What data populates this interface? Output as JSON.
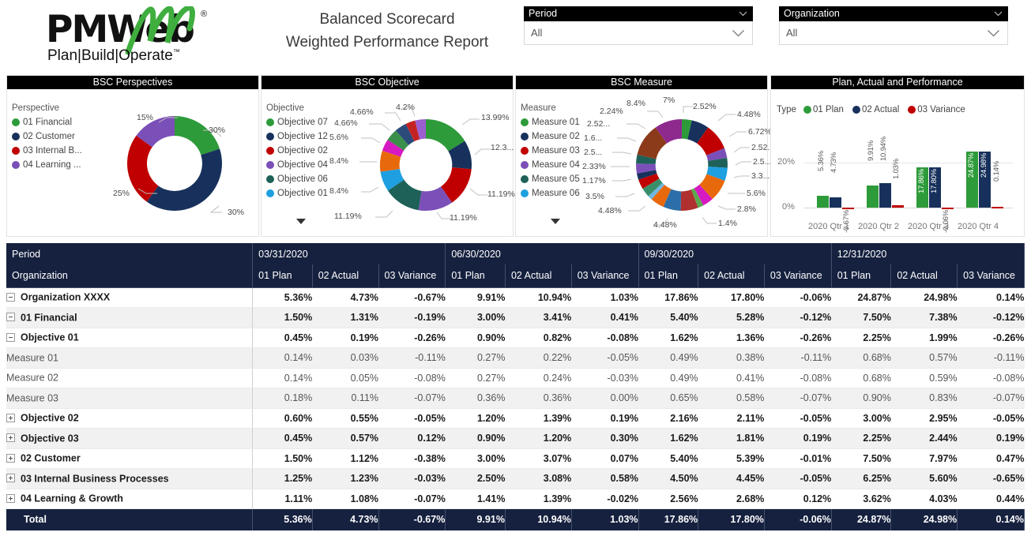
{
  "header": {
    "logo_main": "PMWeb",
    "logo_registered": "®",
    "logo_tagline": "Plan|Build|Operate",
    "logo_tm": "™",
    "title_line1": "Balanced Scorecard",
    "title_line2": "Weighted Performance Report"
  },
  "slicers": [
    {
      "name": "Period",
      "label": "Period",
      "value": "All"
    },
    {
      "name": "Organization",
      "label": "Organization",
      "value": "All"
    }
  ],
  "colors": {
    "green": "#2e9b3a",
    "navy": "#17315c",
    "red": "#c00000",
    "purple": "#7b4fb8",
    "teal": "#1d6158",
    "blue": "#1e9fe0",
    "header_bg": "#16213f",
    "card_title_bg": "#000000"
  },
  "cards": [
    {
      "name": "bsc-perspectives",
      "title": "BSC Perspectives"
    },
    {
      "name": "bsc-objective",
      "title": "BSC Objective"
    },
    {
      "name": "bsc-measure",
      "title": "BSC Measure"
    },
    {
      "name": "plan-actual-performance",
      "title": "Plan, Actual and Performance"
    }
  ],
  "chart_data": [
    {
      "type": "pie",
      "name": "bsc-perspectives",
      "title": "BSC Perspectives",
      "legend_title": "Perspective",
      "legend_position": "left",
      "categories": [
        "01 Financial",
        "02 Customer",
        "03 Internal B...",
        "04 Learning ..."
      ],
      "values": [
        30,
        30,
        25,
        15
      ],
      "data_labels": [
        "30%",
        "30%",
        "25%",
        "15%"
      ],
      "colors": [
        "#2e9b3a",
        "#17315c",
        "#c00000",
        "#7b4fb8"
      ]
    },
    {
      "type": "pie",
      "name": "bsc-objective",
      "title": "BSC Objective",
      "legend_title": "Objective",
      "legend_position": "left",
      "legend_visible": [
        "Objective 07",
        "Objective 12",
        "Objective 02",
        "Objective 04",
        "Objective 06",
        "Objective 01"
      ],
      "legend_colors": [
        "#2e9b3a",
        "#17315c",
        "#c00000",
        "#7b4fb8",
        "#1d6158",
        "#1e9fe0"
      ],
      "legend_truncated": true,
      "values": [
        13.99,
        12.3,
        11.19,
        11.19,
        11.19,
        8.4,
        8.4,
        5.6,
        4.66,
        4.66,
        4.2
      ],
      "data_labels": [
        "13.99%",
        "12.3...",
        "11.19%",
        "11.19%",
        "11.19%",
        "8.4%",
        "8.4%",
        "5.6%",
        "4.66%",
        "4.66%",
        "4.2%"
      ],
      "colors": [
        "#2e9b3a",
        "#17315c",
        "#c00000",
        "#7b4fb8",
        "#1d6158",
        "#1e9fe0",
        "#e8690b",
        "#d619c0",
        "#2e9b3a",
        "#17315c",
        "#c00000"
      ]
    },
    {
      "type": "pie",
      "name": "bsc-measure",
      "title": "BSC Measure",
      "legend_title": "Measure",
      "legend_position": "left",
      "legend_visible": [
        "Measure 01",
        "Measure 02",
        "Measure 03",
        "Measure 04",
        "Measure 05",
        "Measure 06"
      ],
      "legend_colors": [
        "#2e9b3a",
        "#17315c",
        "#c00000",
        "#7b4fb8",
        "#1d6158",
        "#1e9fe0"
      ],
      "legend_truncated": true,
      "values": [
        2.52,
        4.48,
        6.72,
        2.52,
        2.5,
        3.3,
        5.6,
        2.8,
        1.4,
        4.48,
        4.48,
        3.5,
        1.17,
        2.33,
        2.5,
        1.6,
        2.52,
        2.24,
        8.4,
        7
      ],
      "data_labels": [
        "2.52%",
        "4.48%",
        "6.72%",
        "2.52...",
        "2.5...",
        "3.3...",
        "5.6%",
        "2.8%",
        "1.4%",
        "4.48%",
        "4.48%",
        "3.5%",
        "1.17%",
        "2.33%",
        "2.5...",
        "1.6...",
        "2.52...",
        "2.24%",
        "8.4%",
        "7%"
      ],
      "colors": [
        "#2e9b3a",
        "#17315c",
        "#c00000",
        "#7b4fb8",
        "#1d6158",
        "#1e9fe0",
        "#e8690b",
        "#d619c0",
        "#5aa84f",
        "#b03030",
        "#2c6fa8",
        "#e8690b",
        "#6fb8e0",
        "#3a8f6a",
        "#c00000",
        "#17315c",
        "#7b4fb8",
        "#1d6158",
        "#8b3a1a",
        "#8e2a8e"
      ]
    },
    {
      "type": "bar",
      "name": "plan-actual-performance",
      "title": "Plan, Actual and Performance",
      "legend_title": "Type",
      "legend_position": "top",
      "categories": [
        "2020 Qtr 1",
        "2020 Qtr 2",
        "2020 Qtr 3",
        "2020 Qtr 4"
      ],
      "series": [
        {
          "name": "01 Plan",
          "color": "#2e9b3a",
          "values": [
            5.36,
            9.91,
            17.86,
            24.87
          ],
          "labels": [
            "5.36%",
            "9.91%",
            "17.86%",
            "24.87%"
          ]
        },
        {
          "name": "02 Actual",
          "color": "#17315c",
          "values": [
            4.73,
            10.94,
            17.8,
            24.98
          ],
          "labels": [
            "4.73%",
            "10.94%",
            "17.80%",
            "24.98%"
          ]
        },
        {
          "name": "03 Variance",
          "color": "#c00000",
          "values": [
            -0.67,
            1.03,
            -0.06,
            0.14
          ],
          "labels": [
            "-0.67%",
            "1.03%",
            "-0.06%",
            "0.14%"
          ]
        }
      ],
      "ylabel": "",
      "xlabel": "",
      "ytick_labels": [
        "0%",
        "20%"
      ],
      "ylim": [
        -2,
        28
      ],
      "grid": true
    }
  ],
  "matrix": {
    "row_header_label_1": "Period",
    "row_header_label_2": "Organization",
    "period_groups": [
      "03/31/2020",
      "06/30/2020",
      "09/30/2020",
      "12/31/2020"
    ],
    "measure_columns": [
      "01 Plan",
      "02 Actual",
      "03 Variance"
    ],
    "rows": [
      {
        "label": "Organization XXXX",
        "indent": 0,
        "toggle": "minus",
        "bold": true,
        "values": [
          "5.36%",
          "4.73%",
          "-0.67%",
          "9.91%",
          "10.94%",
          "1.03%",
          "17.86%",
          "17.80%",
          "-0.06%",
          "24.87%",
          "24.98%",
          "0.14%"
        ]
      },
      {
        "label": "01 Financial",
        "indent": 1,
        "toggle": "minus",
        "bold": true,
        "values": [
          "1.50%",
          "1.31%",
          "-0.19%",
          "3.00%",
          "3.41%",
          "0.41%",
          "5.40%",
          "5.28%",
          "-0.12%",
          "7.50%",
          "7.38%",
          "-0.12%"
        ]
      },
      {
        "label": "Objective 01",
        "indent": 2,
        "toggle": "minus",
        "bold": true,
        "values": [
          "0.45%",
          "0.19%",
          "-0.26%",
          "0.90%",
          "0.82%",
          "-0.08%",
          "1.62%",
          "1.36%",
          "-0.26%",
          "2.25%",
          "1.99%",
          "-0.26%"
        ]
      },
      {
        "label": "Measure 01",
        "indent": 3,
        "toggle": "none",
        "bold": false,
        "values": [
          "0.14%",
          "0.03%",
          "-0.11%",
          "0.27%",
          "0.22%",
          "-0.05%",
          "0.49%",
          "0.38%",
          "-0.11%",
          "0.68%",
          "0.57%",
          "-0.11%"
        ]
      },
      {
        "label": "Measure 02",
        "indent": 3,
        "toggle": "none",
        "bold": false,
        "values": [
          "0.14%",
          "0.05%",
          "-0.08%",
          "0.27%",
          "0.24%",
          "-0.03%",
          "0.49%",
          "0.41%",
          "-0.08%",
          "0.68%",
          "0.59%",
          "-0.08%"
        ]
      },
      {
        "label": "Measure 03",
        "indent": 3,
        "toggle": "none",
        "bold": false,
        "values": [
          "0.18%",
          "0.11%",
          "-0.07%",
          "0.36%",
          "0.36%",
          "0.00%",
          "0.65%",
          "0.58%",
          "-0.07%",
          "0.90%",
          "0.83%",
          "-0.07%"
        ]
      },
      {
        "label": "Objective 02",
        "indent": 2,
        "toggle": "plus",
        "bold": true,
        "values": [
          "0.60%",
          "0.55%",
          "-0.05%",
          "1.20%",
          "1.39%",
          "0.19%",
          "2.16%",
          "2.11%",
          "-0.05%",
          "3.00%",
          "2.95%",
          "-0.05%"
        ]
      },
      {
        "label": "Objective 03",
        "indent": 2,
        "toggle": "plus",
        "bold": true,
        "values": [
          "0.45%",
          "0.57%",
          "0.12%",
          "0.90%",
          "1.20%",
          "0.30%",
          "1.62%",
          "1.81%",
          "0.19%",
          "2.25%",
          "2.44%",
          "0.19%"
        ]
      },
      {
        "label": "02 Customer",
        "indent": 1,
        "toggle": "plus",
        "bold": true,
        "values": [
          "1.50%",
          "1.12%",
          "-0.38%",
          "3.00%",
          "3.07%",
          "0.07%",
          "5.40%",
          "5.39%",
          "-0.01%",
          "7.50%",
          "7.97%",
          "0.47%"
        ]
      },
      {
        "label": "03 Internal Business Processes",
        "indent": 1,
        "toggle": "plus",
        "bold": true,
        "values": [
          "1.25%",
          "1.23%",
          "-0.03%",
          "2.50%",
          "3.08%",
          "0.58%",
          "4.50%",
          "4.45%",
          "-0.05%",
          "6.25%",
          "5.60%",
          "-0.65%"
        ]
      },
      {
        "label": "04 Learning & Growth",
        "indent": 1,
        "toggle": "plus",
        "bold": true,
        "values": [
          "1.11%",
          "1.08%",
          "-0.07%",
          "1.41%",
          "1.39%",
          "-0.02%",
          "2.56%",
          "2.68%",
          "0.12%",
          "3.62%",
          "4.03%",
          "0.44%"
        ]
      }
    ],
    "total": {
      "label": "Total",
      "values": [
        "5.36%",
        "4.73%",
        "-0.67%",
        "9.91%",
        "10.94%",
        "1.03%",
        "17.86%",
        "17.80%",
        "-0.06%",
        "24.87%",
        "24.98%",
        "0.14%"
      ]
    }
  }
}
